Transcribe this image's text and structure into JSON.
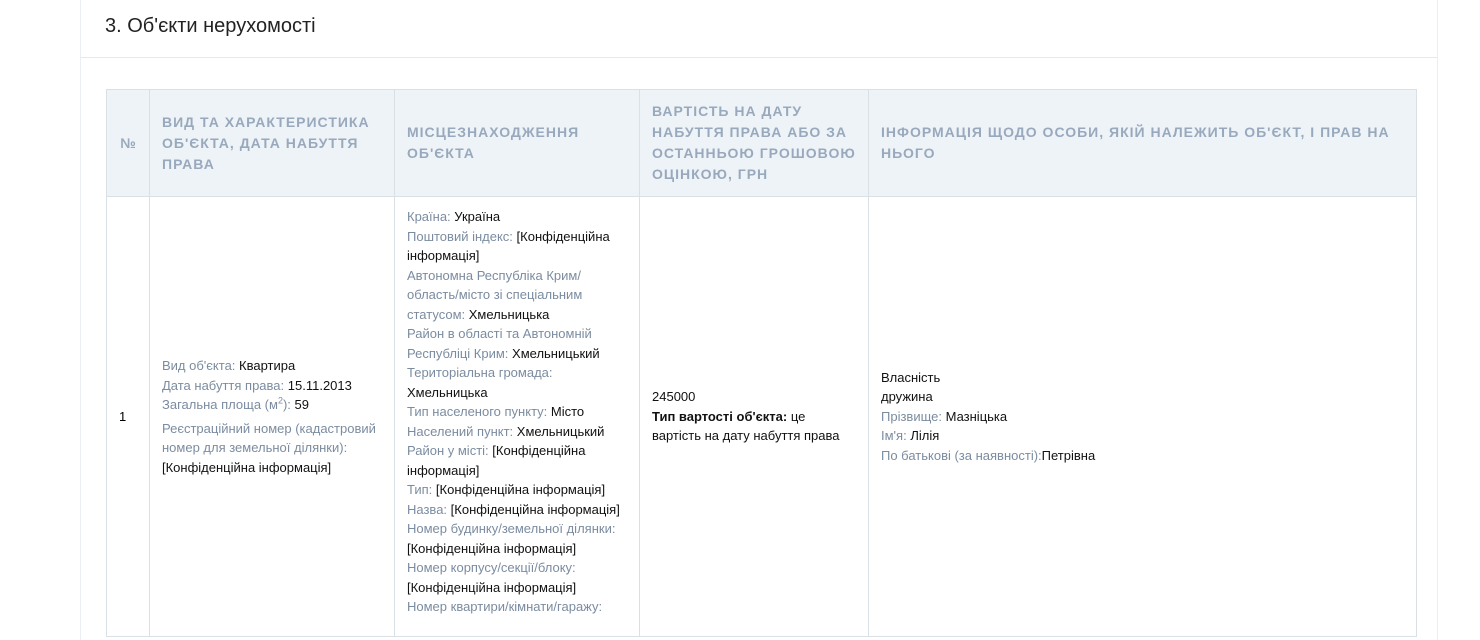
{
  "section": {
    "title": "3. Об'єкти нерухомості"
  },
  "table": {
    "headers": [
      "№",
      "ВИД ТА ХАРАКТЕРИСТИКА ОБ'ЄКТА, ДАТА НАБУТТЯ ПРАВА",
      "МІСЦЕЗНАХОДЖЕННЯ ОБ'ЄКТА",
      "ВАРТІСТЬ НА ДАТУ НАБУТТЯ ПРАВА АБО ЗА ОСТАННЬОЮ ГРОШОВОЮ ОЦІНКОЮ, ГРН",
      "ІНФОРМАЦІЯ ЩОДО ОСОБИ, ЯКІЙ НАЛЕЖИТЬ ОБ'ЄКТ, І ПРАВ НА НЬОГО"
    ],
    "row": {
      "num": "1",
      "object": {
        "type_label": "Вид об'єкта:",
        "type_value": "Квартира",
        "date_label": "Дата набуття права:",
        "date_value": "15.11.2013",
        "area_label_pre": "Загальна площа (м",
        "area_label_sup": "2",
        "area_label_post": "):",
        "area_value": "59",
        "reg_label": "Реєстраційний номер (кадастровий номер для земельної ділянки):",
        "reg_value": "[Конфіденційна інформація]"
      },
      "location": {
        "country_label": "Країна:",
        "country_value": "Україна",
        "postal_label": "Поштовий індекс:",
        "postal_value": "[Конфіденційна інформація]",
        "region_label": "Автономна Республіка Крим/ область/місто зі спеціальним статусом:",
        "region_value": "Хмельницька",
        "district_label": "Район в області та Автономній Республіці Крим:",
        "district_value": "Хмельницький",
        "community_label": "Територіальна громада:",
        "community_value": "Хмельницька",
        "settlement_type_label": "Тип населеного пункту:",
        "settlement_type_value": "Місто",
        "settlement_label": "Населений пункт:",
        "settlement_value": "Хмельницький",
        "city_district_label": "Район у місті:",
        "city_district_value": "[Конфіденційна інформація]",
        "street_type_label": "Тип:",
        "street_type_value": "[Конфіденційна інформація]",
        "street_name_label": "Назва:",
        "street_name_value": "[Конфіденційна інформація]",
        "house_label": "Номер будинку/земельної ділянки:",
        "house_value": "[Конфіденційна інформація]",
        "building_label": "Номер корпусу/секції/блоку:",
        "building_value": "[Конфіденційна інформація]",
        "apartment_label": "Номер квартири/кімнати/гаражу:"
      },
      "value": {
        "amount": "245000",
        "type_label": "Тип вартості об'єкта:",
        "type_value": "це вартість на дату набуття права"
      },
      "owner": {
        "right_type": "Власність",
        "relation": "дружина",
        "surname_label": "Прізвище:",
        "surname_value": "Мазніцька",
        "name_label": "Ім'я:",
        "name_value": "Лілія",
        "patronymic_label": "По батькові (за наявності):",
        "patronymic_value": "Петрівна"
      }
    }
  }
}
